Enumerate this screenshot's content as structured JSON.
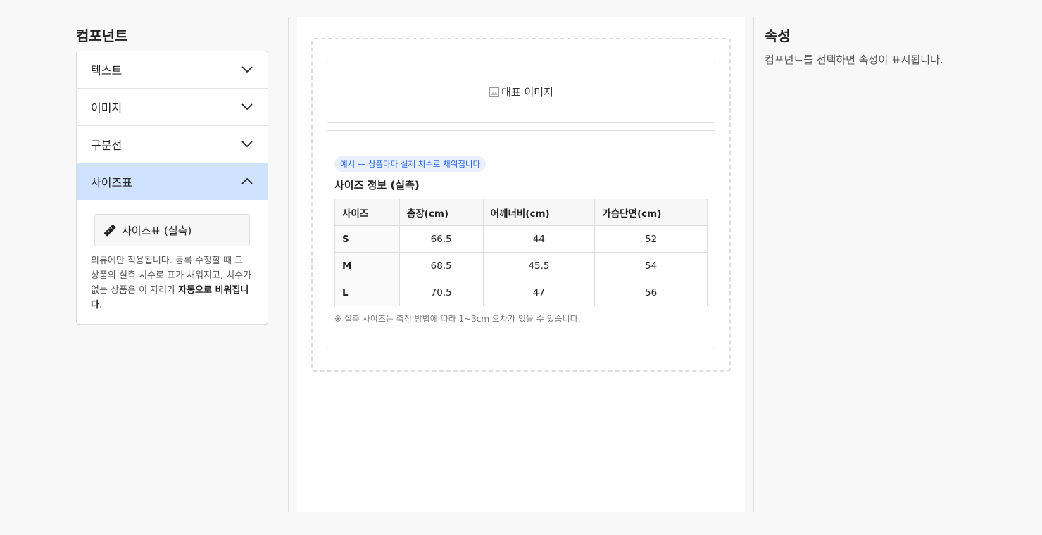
{
  "left_panel": {
    "title": "컴포넌트",
    "accordion": [
      {
        "label": "텍스트",
        "expanded": false
      },
      {
        "label": "이미지",
        "expanded": false
      },
      {
        "label": "구분선",
        "expanded": false
      },
      {
        "label": "사이즈표",
        "expanded": true
      }
    ],
    "size_chip": {
      "label": "사이즈표 (실측)",
      "icon": "ruler-icon"
    },
    "help_text": {
      "line1": "의류에만 적용됩니다. 등록·수정할 때 그 상품의 실측 치수로 표가 채워지고, 치수가 없는 상품은 이 자리가 ",
      "bold": "자동으로 비워집니다",
      "end": "."
    }
  },
  "canvas": {
    "image_alt": "대표 이미지",
    "size_block": {
      "badge": "예시 — 상품마다 실제 치수로 채워집니다",
      "title": "사이즈 정보 (실측)",
      "headers": [
        "사이즈",
        "총장(cm)",
        "어깨너비(cm)",
        "가슴단면(cm)"
      ],
      "rows": [
        [
          "S",
          "66.5",
          "44",
          "52"
        ],
        [
          "M",
          "68.5",
          "45.5",
          "54"
        ],
        [
          "L",
          "70.5",
          "47",
          "56"
        ]
      ],
      "note": "※ 실측 사이즈는 측정 방법에 따라 1~3cm 오차가 있을 수 있습니다."
    }
  },
  "right_panel": {
    "title": "속성",
    "description": "컴포넌트를 선택하면 속성이 표시됩니다."
  },
  "colors": {
    "active_accordion": "#cfe2ff",
    "badge_bg": "#e8f0fe",
    "badge_text": "#2563eb"
  }
}
